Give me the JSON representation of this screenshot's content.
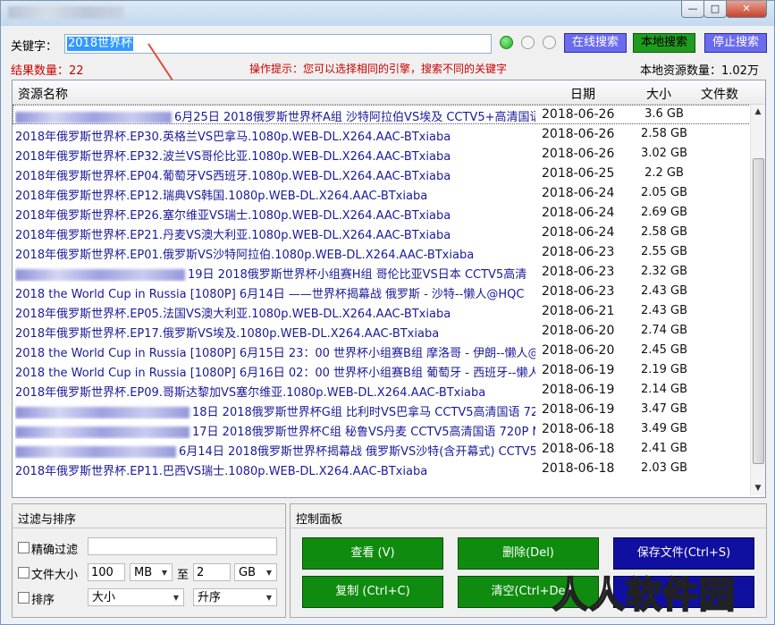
{
  "window": {
    "minimize": "—",
    "maximize": "□",
    "close": "✕"
  },
  "search": {
    "label": "关键字：",
    "value": "2018世界杯"
  },
  "engines": [
    {
      "icon": "engine-dot-green-icon",
      "active": true
    },
    {
      "icon": "engine-dot-icon",
      "active": false
    },
    {
      "icon": "engine-dot-icon",
      "active": false
    }
  ],
  "toolbar": {
    "online_search": "在线搜索",
    "local_search": "本地搜索",
    "stop_search": "停止搜索"
  },
  "status": {
    "result_count": "结果数量：22",
    "hint": "操作提示：您可以选择相同的引擎，搜索不同的关键字",
    "local_count": "本地资源数量：1.02万"
  },
  "columns": {
    "name": "资源名称",
    "date": "日期",
    "size": "大小",
    "files": "文件数"
  },
  "rows": [
    {
      "name": "6月25日 2018俄罗斯世界杯A组 沙特阿拉伯VS埃及 CCTV5+高清国语",
      "date": "2018-06-26",
      "size": "3.6 GB"
    },
    {
      "name": "2018年俄罗斯世界杯.EP30.英格兰VS巴拿马.1080p.WEB-DL.X264.AAC-BTxiaba",
      "date": "2018-06-26",
      "size": "2.58 GB"
    },
    {
      "name": "2018年俄罗斯世界杯.EP32.波兰VS哥伦比亚.1080p.WEB-DL.X264.AAC-BTxiaba",
      "date": "2018-06-26",
      "size": "3.02 GB"
    },
    {
      "name": "2018年俄罗斯世界杯.EP04.葡萄牙VS西班牙.1080p.WEB-DL.X264.AAC-BTxiaba",
      "date": "2018-06-25",
      "size": "2.2 GB"
    },
    {
      "name": "2018年俄罗斯世界杯.EP12.瑞典VS韩国.1080p.WEB-DL.X264.AAC-BTxiaba",
      "date": "2018-06-24",
      "size": "2.05 GB"
    },
    {
      "name": "2018年俄罗斯世界杯.EP26.塞尔维亚VS瑞士.1080p.WEB-DL.X264.AAC-BTxiaba",
      "date": "2018-06-24",
      "size": "2.69 GB"
    },
    {
      "name": "2018年俄罗斯世界杯.EP21.丹麦VS澳大利亚.1080p.WEB-DL.X264.AAC-BTxiaba",
      "date": "2018-06-24",
      "size": "2.58 GB"
    },
    {
      "name": "2018年俄罗斯世界杯.EP01.俄罗斯VS沙特阿拉伯.1080p.WEB-DL.X264.AAC-BTxiaba",
      "date": "2018-06-23",
      "size": "2.55 GB"
    },
    {
      "name": "19日 2018俄罗斯世界杯小组赛H组 哥伦比亚VS日本 CCTV5高清",
      "date": "2018-06-23",
      "size": "2.32 GB"
    },
    {
      "name": "2018 the World Cup in Russia [1080P]  6月14日 ——世界杯揭幕战 俄罗斯 - 沙特--懒人@HQC",
      "date": "2018-06-23",
      "size": "2.43 GB"
    },
    {
      "name": "2018年俄罗斯世界杯.EP05.法国VS澳大利亚.1080p.WEB-DL.X264.AAC-BTxiaba",
      "date": "2018-06-21",
      "size": "2.43 GB"
    },
    {
      "name": "2018年俄罗斯世界杯.EP17.俄罗斯VS埃及.1080p.WEB-DL.X264.AAC-BTxiaba",
      "date": "2018-06-20",
      "size": "2.74 GB"
    },
    {
      "name": "2018 the World Cup in Russia [1080P] 6月15日 23：00  世界杯小组赛B组 摩洛哥 - 伊朗--懒人@H",
      "date": "2018-06-20",
      "size": "2.45 GB"
    },
    {
      "name": "2018 the World Cup in Russia [1080P]  6月16日 02：00  世界杯小组赛B组 葡萄牙 - 西班牙--懒人@",
      "date": "2018-06-19",
      "size": "2.19 GB"
    },
    {
      "name": "2018年俄罗斯世界杯.EP09.哥斯达黎加VS塞尔维亚.1080p.WEB-DL.X264.AAC-BTxiaba",
      "date": "2018-06-19",
      "size": "2.14 GB"
    },
    {
      "name": "18日 2018俄罗斯世界杯G组 比利时VS巴拿马 CCTV5高清国语 72",
      "date": "2018-06-19",
      "size": "3.47 GB"
    },
    {
      "name": "17日 2018俄罗斯世界杯C组 秘鲁VS丹麦 CCTV5高清国语 720P M",
      "date": "2018-06-18",
      "size": "3.49 GB"
    },
    {
      "name": "6月14日 2018俄罗斯世界杯揭幕战 俄罗斯VS沙特(含开幕式) CCTV5高",
      "date": "2018-06-18",
      "size": "2.41 GB"
    },
    {
      "name": "2018年俄罗斯世界杯.EP11.巴西VS瑞士.1080p.WEB-DL.X264.AAC-BTxiaba",
      "date": "2018-06-18",
      "size": "2.03 GB"
    }
  ],
  "filter": {
    "title": "过滤与排序",
    "exact_label": "精确过滤",
    "exact_value": "",
    "size_label": "文件大小",
    "size_min": "100",
    "size_min_unit": "MB",
    "to_label": "至",
    "size_max": "2",
    "size_max_unit": "GB",
    "sort_label": "排序",
    "sort_by": "大小",
    "sort_order": "升序"
  },
  "control": {
    "title": "控制面板",
    "view": "查看 (V)",
    "delete": "删除(Del)",
    "save": "保存文件(Ctrl+S)",
    "copy": "复制 (Ctrl+C)",
    "clear": "清空(Ctrl+De"
  },
  "watermark": {
    "text": "人人软件园"
  },
  "colors": {
    "accent_blue": "#6b6bef",
    "accent_green": "#1f9b1f",
    "hint_red": "#cc0000",
    "arrow_red": "#e0483a"
  }
}
